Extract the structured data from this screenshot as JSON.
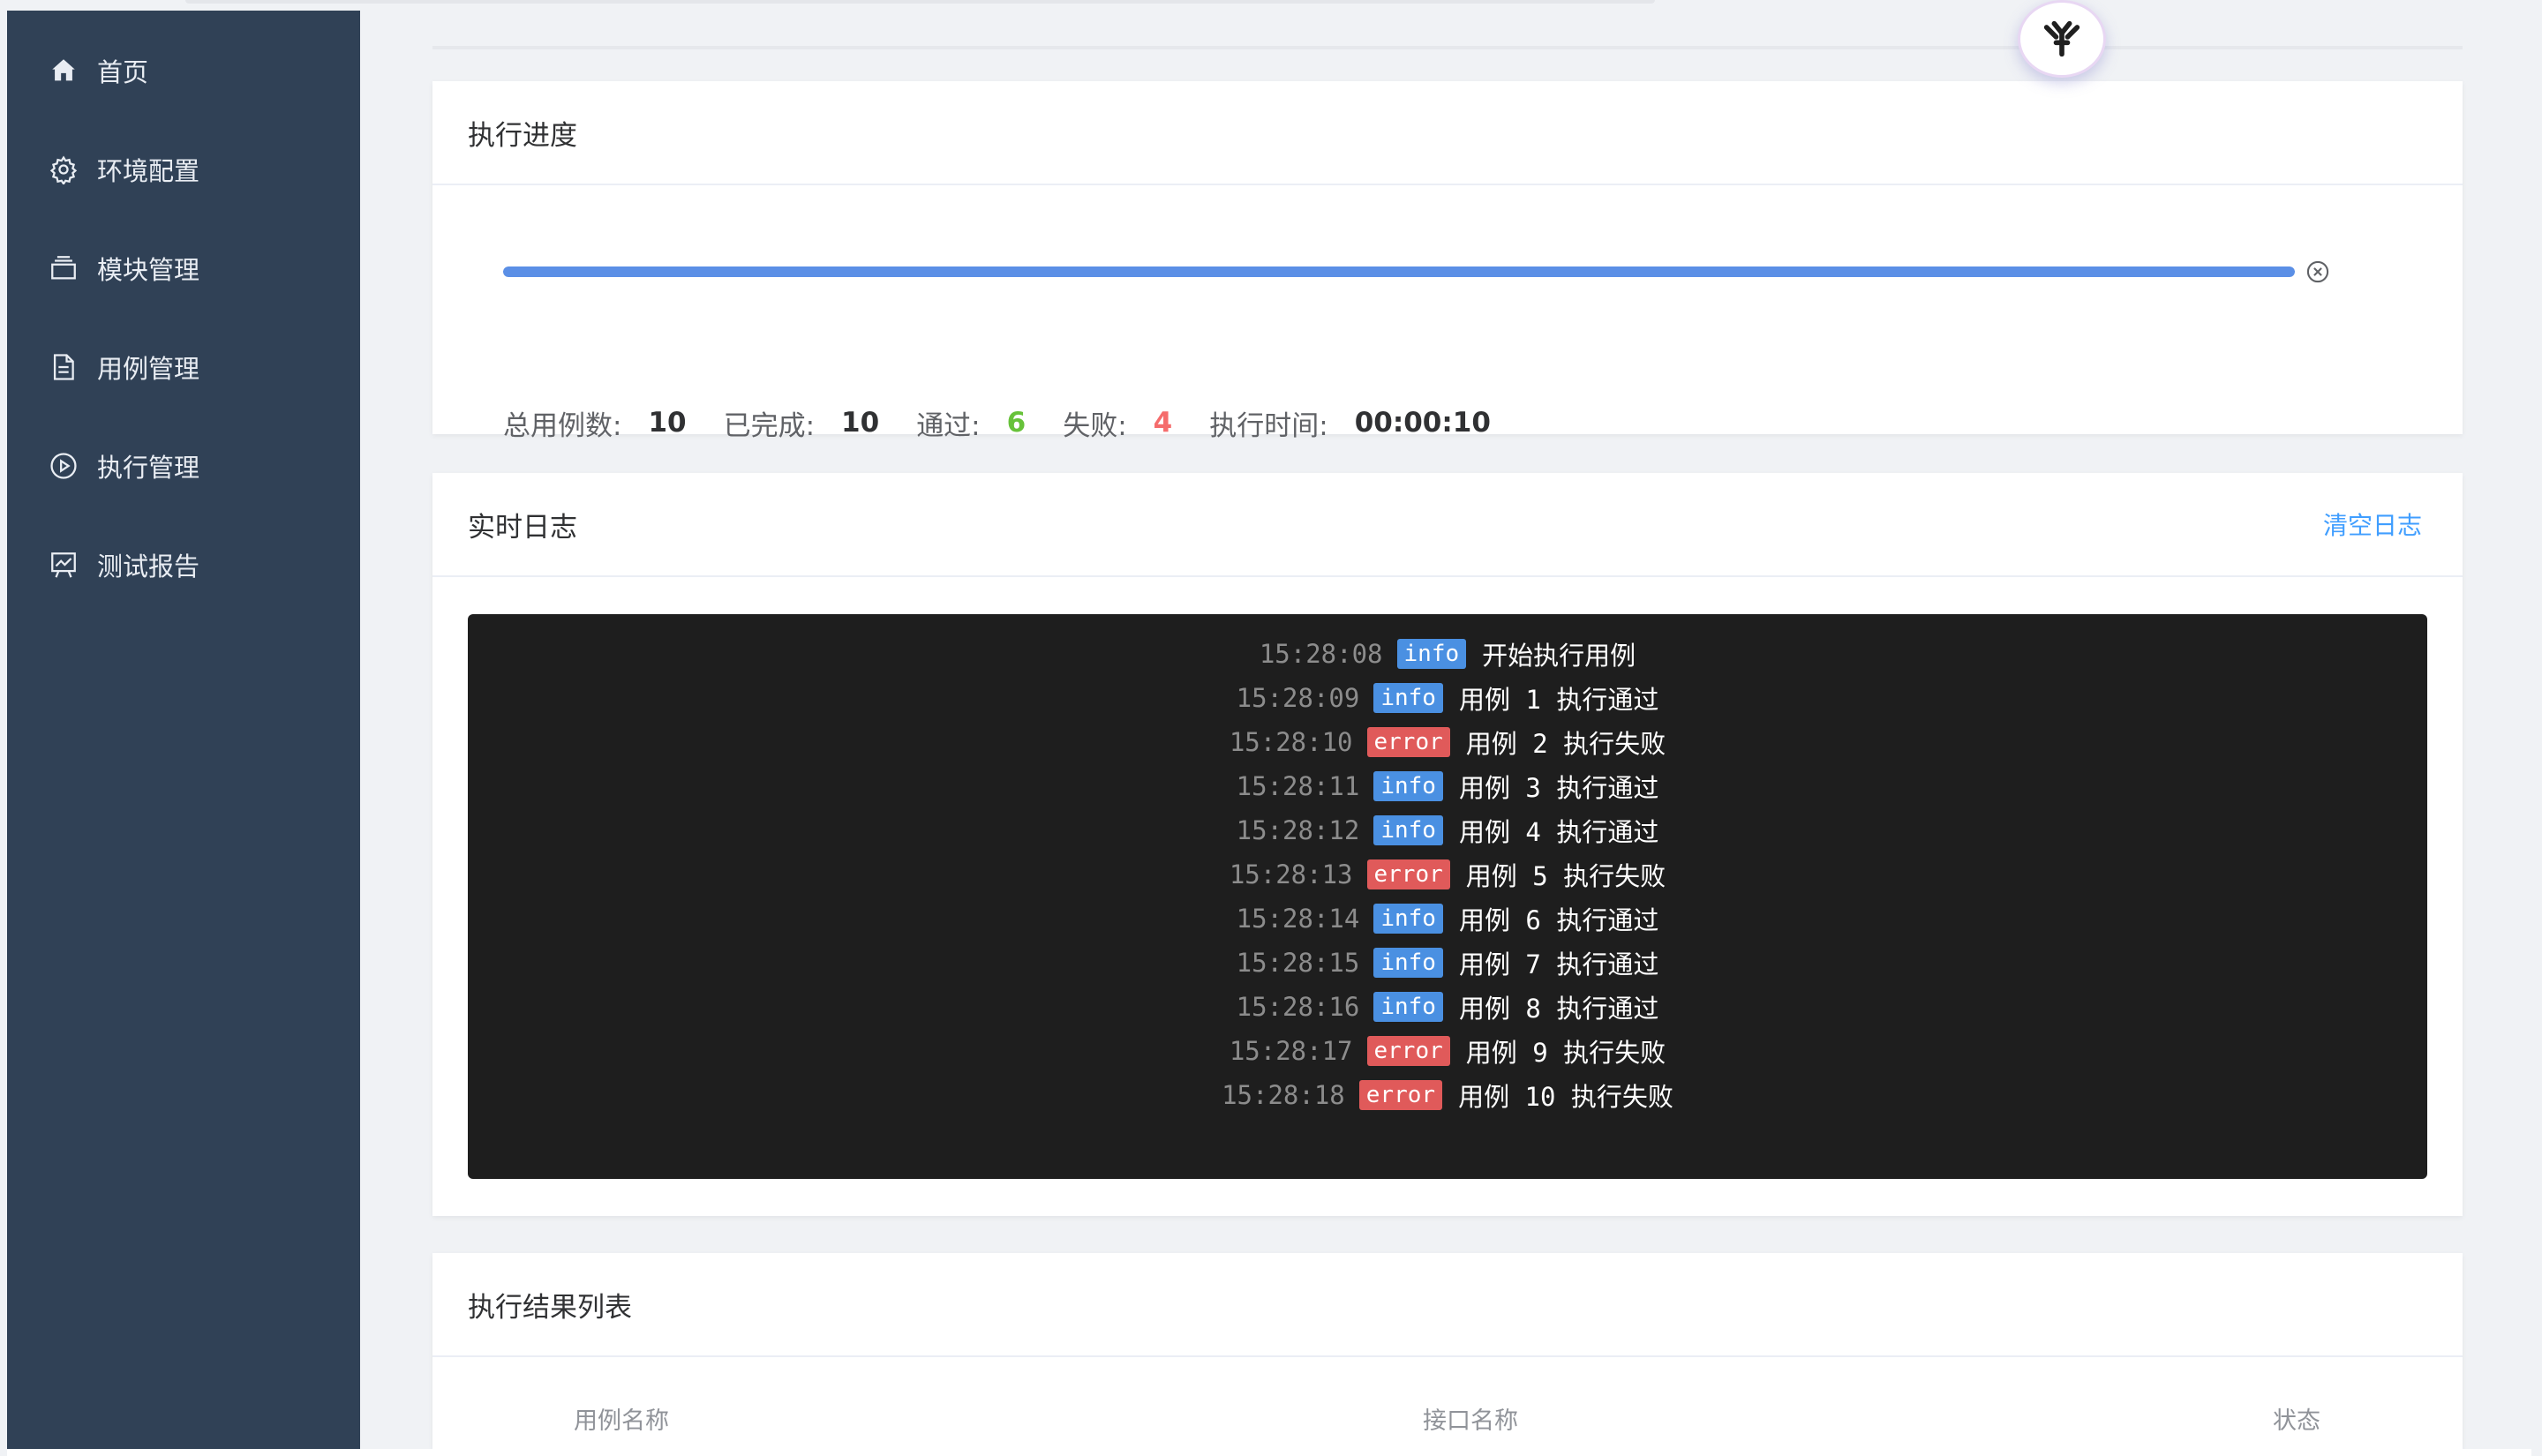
{
  "sidebar": {
    "items": [
      {
        "label": "首页",
        "icon": "home-icon"
      },
      {
        "label": "环境配置",
        "icon": "gear-icon"
      },
      {
        "label": "模块管理",
        "icon": "box-icon"
      },
      {
        "label": "用例管理",
        "icon": "document-icon"
      },
      {
        "label": "执行管理",
        "icon": "play-circle-icon"
      },
      {
        "label": "测试报告",
        "icon": "chart-board-icon"
      }
    ]
  },
  "progress_card": {
    "title": "执行进度",
    "progress_fraction": 1.0,
    "stats": {
      "total_label": "总用例数:",
      "total_value": "10",
      "done_label": "已完成:",
      "done_value": "10",
      "pass_label": "通过:",
      "pass_value": "6",
      "fail_label": "失败:",
      "fail_value": "4",
      "time_label": "执行时间:",
      "time_value": "00:00:10"
    }
  },
  "log_card": {
    "title": "实时日志",
    "clear_label": "清空日志",
    "lines": [
      {
        "time": "15:28:08",
        "level": "info",
        "message": "开始执行用例"
      },
      {
        "time": "15:28:09",
        "level": "info",
        "message": "用例 1 执行通过"
      },
      {
        "time": "15:28:10",
        "level": "error",
        "message": "用例 2 执行失败"
      },
      {
        "time": "15:28:11",
        "level": "info",
        "message": "用例 3 执行通过"
      },
      {
        "time": "15:28:12",
        "level": "info",
        "message": "用例 4 执行通过"
      },
      {
        "time": "15:28:13",
        "level": "error",
        "message": "用例 5 执行失败"
      },
      {
        "time": "15:28:14",
        "level": "info",
        "message": "用例 6 执行通过"
      },
      {
        "time": "15:28:15",
        "level": "info",
        "message": "用例 7 执行通过"
      },
      {
        "time": "15:28:16",
        "level": "info",
        "message": "用例 8 执行通过"
      },
      {
        "time": "15:28:17",
        "level": "error",
        "message": "用例 9 执行失败"
      },
      {
        "time": "15:28:18",
        "level": "error",
        "message": "用例 10 执行失败"
      }
    ]
  },
  "results_card": {
    "title": "执行结果列表",
    "columns": [
      "用例名称",
      "接口名称",
      "状态"
    ]
  },
  "colors": {
    "sidebar_bg": "#304156",
    "accent": "#409eff",
    "pass": "#67c23a",
    "fail": "#f56c6c",
    "info_badge": "#4a90e2",
    "error_badge": "#e05a5a"
  }
}
